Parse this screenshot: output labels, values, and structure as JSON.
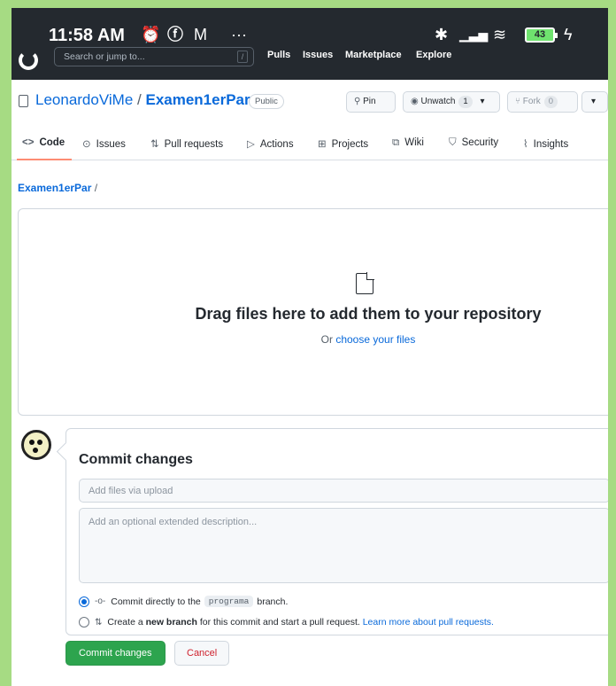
{
  "status_bar": {
    "time": "11:58 AM",
    "battery": "43"
  },
  "github_header": {
    "search_placeholder": "Search or jump to...",
    "search_key": "/",
    "links": [
      "Pulls",
      "Issues",
      "Marketplace",
      "Explore"
    ]
  },
  "repo": {
    "owner": "LeonardoViMe",
    "separator": "/",
    "name": "Examen1erPar",
    "visibility": "Public",
    "pin_label": "Pin",
    "unwatch_label": "Unwatch",
    "watch_count": "1",
    "fork_label": "Fork",
    "fork_count": "0"
  },
  "tabs": [
    {
      "label": "Code",
      "icon": "<>"
    },
    {
      "label": "Issues",
      "icon": "⊙"
    },
    {
      "label": "Pull requests",
      "icon": "⇅"
    },
    {
      "label": "Actions",
      "icon": "▷"
    },
    {
      "label": "Projects",
      "icon": "⊞"
    },
    {
      "label": "Wiki",
      "icon": "⧉"
    },
    {
      "label": "Security",
      "icon": "⛉"
    },
    {
      "label": "Insights",
      "icon": "⌇"
    }
  ],
  "breadcrumb": {
    "repo": "Examen1erPar",
    "slash": "/"
  },
  "dropzone": {
    "title": "Drag files here to add them to your repository",
    "or_text": "Or",
    "choose_link": "choose your files"
  },
  "commit": {
    "heading": "Commit changes",
    "summary_placeholder": "Add files via upload",
    "description_placeholder": "Add an optional extended description...",
    "option_direct": {
      "prefix": "Commit directly to the",
      "branch": "programa",
      "suffix": "branch."
    },
    "option_new": {
      "prefix": "Create a",
      "bold": "new branch",
      "middle": "for this commit and start a pull request.",
      "link": "Learn more about pull requests."
    },
    "commit_button": "Commit changes",
    "cancel_button": "Cancel"
  },
  "colors": {
    "accent_link": "#0969da",
    "commit_green": "#2da44e",
    "cancel_red": "#cf222e",
    "header_dark": "#24292f",
    "border_green": "#a6db83"
  }
}
